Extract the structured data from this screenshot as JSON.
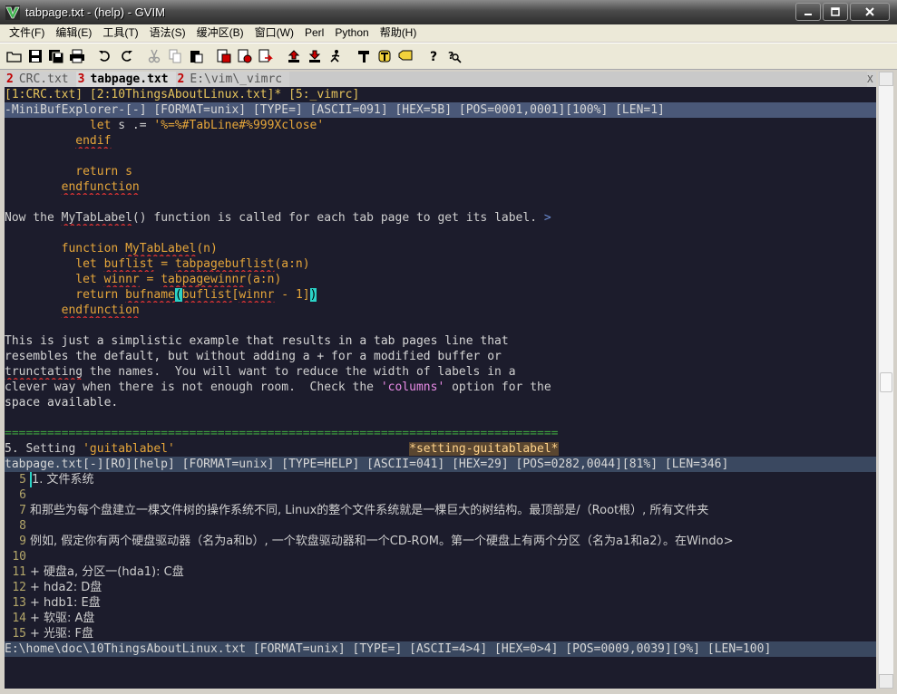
{
  "window": {
    "title": "tabpage.txt - (help) - GVIM"
  },
  "menu": [
    "文件(F)",
    "编辑(E)",
    "工具(T)",
    "语法(S)",
    "缓冲区(B)",
    "窗口(W)",
    "Perl",
    "Python",
    "帮助(H)"
  ],
  "tabs": [
    {
      "num": "2",
      "label": "CRC.txt",
      "selected": false
    },
    {
      "num": "3",
      "label": "tabpage.txt",
      "selected": true
    },
    {
      "num": "2",
      "label": "E:\\vim\\_vimrc",
      "selected": false
    }
  ],
  "tab_close": "X",
  "minibuf": {
    "line": "[1:CRC.txt] [2:10ThingsAboutLinux.txt]* [5:_vimrc]"
  },
  "status_top": "-MiniBufExplorer-[-] [FORMAT=unix] [TYPE=] [ASCII=091] [HEX=5B] [POS=0001,0001][100%] [LEN=1]",
  "help_lines": [
    "            let s .= '%=%#TabLine#%999Xclose'",
    "          endif",
    "",
    "          return s",
    "        endfunction",
    "",
    "Now the MyTabLabel() function is called for each tab page to get its label. >",
    "",
    "        function MyTabLabel(n)",
    "          let buflist = tabpagebuflist(a:n)",
    "          let winnr = tabpagewinnr(a:n)",
    "          return bufname(buflist[winnr - 1])",
    "        endfunction",
    "",
    "This is just a simplistic example that results in a tab pages line that",
    "resembles the default, but without adding a + for a modified buffer or",
    "trunctating the names.  You will want to reduce the width of labels in a",
    "clever way when there is not enough room.  Check the 'columns' option for the",
    "space available.",
    "",
    "==============================================================================",
    "5. Setting 'guitablabel'                                 *setting-guitablabel*"
  ],
  "status_mid": "tabpage.txt[-][RO][help] [FORMAT=unix] [TYPE=HELP] [ASCII=041] [HEX=29] [POS=0282,0044][81%] [LEN=346]",
  "bottom_lines": [
    {
      "n": "5",
      "t": "1. 文件系统"
    },
    {
      "n": "6",
      "t": ""
    },
    {
      "n": "7",
      "t": "和那些为每个盘建立一棵文件树的操作系统不同, Linux的整个文件系统就是一棵巨大的树结构。最顶部是/（Root根）, 所有文件夹"
    },
    {
      "n": "8",
      "t": ""
    },
    {
      "n": "9",
      "t": "例如, 假定你有两个硬盘驱动器（名为a和b）, 一个软盘驱动器和一个CD-ROM。第一个硬盘上有两个分区（名为a1和a2）。在Windo>"
    },
    {
      "n": "10",
      "t": ""
    },
    {
      "n": "11",
      "t": "+ 硬盘a, 分区一(hda1): C盘"
    },
    {
      "n": "12",
      "t": "+ hda2: D盘"
    },
    {
      "n": "13",
      "t": "+ hdb1: E盘"
    },
    {
      "n": "14",
      "t": "+ 软驱: A盘"
    },
    {
      "n": "15",
      "t": "+ 光驱: F盘"
    }
  ],
  "status_bottom": "E:\\home\\doc\\10ThingsAboutLinux.txt [FORMAT=unix] [TYPE=] [ASCII=4>4] [HEX=0>4] [POS=0009,0039][9%] [LEN=100]",
  "colors": {
    "editor_bg": "#1c1c2c",
    "status_bg": "#3a4860",
    "keyword": "#e6a63a",
    "cursor": "#2bd3c7"
  }
}
